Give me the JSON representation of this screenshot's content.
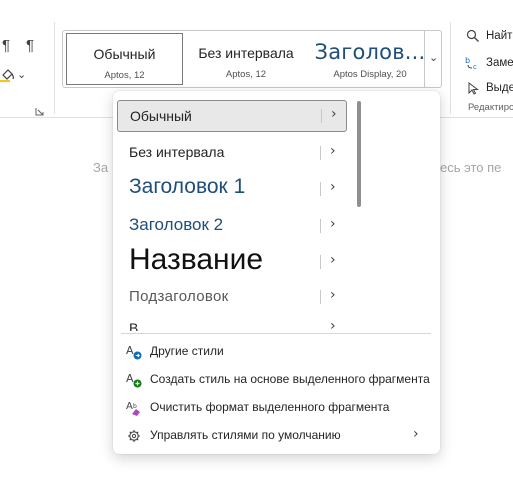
{
  "ribbon": {
    "pilcrow_1": "¶",
    "pilcrow_2": "¶",
    "styles": [
      {
        "name": "Обычный",
        "font": "Aptos, 12"
      },
      {
        "name": "Без интервала",
        "font": "Aptos, 12"
      },
      {
        "name": "Заголов...",
        "font": "Aptos Display, 20"
      }
    ],
    "find_label": "Найт",
    "replace_label": "Заме",
    "select_label": "Выде",
    "group_label": "Редактиро"
  },
  "document": {
    "ghost_left": "За",
    "ghost_right": "есь это пе"
  },
  "menu": {
    "styles": [
      {
        "label": "Обычный",
        "selected": true
      },
      {
        "label": "Без интервала"
      },
      {
        "label": "Заголовок 1"
      },
      {
        "label": "Заголовок 2"
      },
      {
        "label": "Название"
      },
      {
        "label": "Подзаголовок"
      },
      {
        "label": "В"
      }
    ],
    "commands": [
      {
        "label": "Другие стили",
        "icon": "styles-pane-icon"
      },
      {
        "label": "Создать стиль на основе выделенного фрагмента",
        "icon": "create-style-icon"
      },
      {
        "label": "Очистить формат выделенного фрагмента",
        "icon": "clear-formatting-icon"
      },
      {
        "label": "Управлять стилями по умолчанию",
        "icon": "gear-icon",
        "chevron": "›"
      }
    ]
  },
  "colors": {
    "heading_blue": "#1f4e79",
    "accent_blue": "#0f6cbd",
    "muted_text": "#595959"
  }
}
